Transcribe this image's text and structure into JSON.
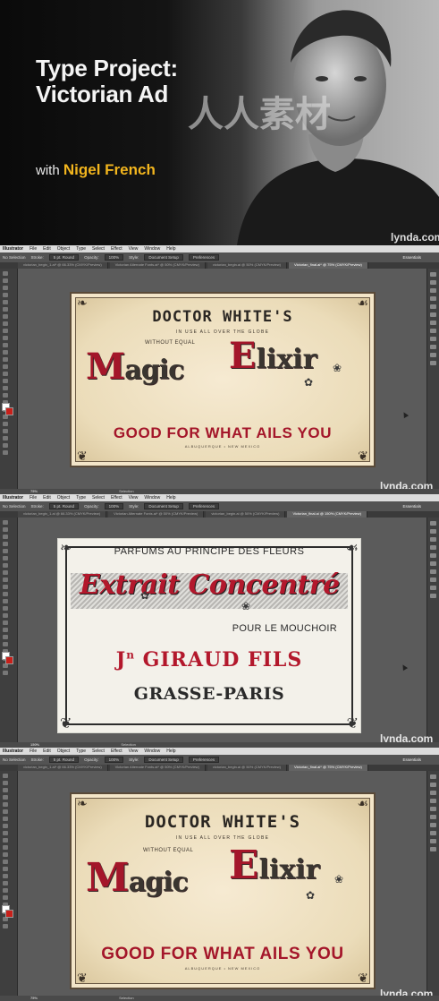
{
  "title_card": {
    "line1": "Type Project:",
    "line2": "Victorian Ad",
    "with_prefix": "with",
    "presenter": "Nigel French",
    "brand": "lynda.com",
    "accent_color": "#f2b51e"
  },
  "app": {
    "menu_app": "Illustrator",
    "menu": [
      "File",
      "Edit",
      "Object",
      "Type",
      "Select",
      "Effect",
      "View",
      "Window",
      "Help"
    ],
    "control": {
      "selection": "No Selection",
      "stroke_label": "Stroke:",
      "stroke_value": "5 pt. Round",
      "opacity_label": "Opacity:",
      "opacity_value": "100%",
      "style_label": "Style:",
      "doc_setup": "Document Setup",
      "preferences": "Preferences",
      "workspace": "Essentials"
    },
    "tabs": [
      "victorian_begin_1.ai* @ 66.33% (CMYK/Preview)",
      "Victorian Alternate Fonts.ai* @ 50% (CMYK/Preview)",
      "victorian_begin.ai @ 50% (CMYK/Preview)",
      "Victorian_final.ai* @ 75% (CMYK/Preview)"
    ],
    "tabs_frame2": [
      "victorian_begin_1.ai @ 66.33% (CMYK/Preview)",
      "Victorian Alternate Fonts.ai* @ 50% (CMYK/Preview)",
      "victorian_begin.ai @ 50% (CMYK/Preview)",
      "Victorian_final.ai @ 150% (CMYK/Preview)"
    ],
    "status_zoom": "75%",
    "status_zoom2": "150%",
    "status_tool": "Selection"
  },
  "ad": {
    "headline": "DOCTOR WHITE'S",
    "subline": "IN USE ALL OVER THE GLOBE",
    "without": "WITHOUT EQUAL",
    "magic_cap": "M",
    "magic_rest": "agic",
    "elixir_cap": "E",
    "elixir_rest": "lixir",
    "tagline": "GOOD FOR WHAT AILS YOU",
    "location": "ALBUQUERQUE • NEW MEXICO"
  },
  "perfume": {
    "line1": "PARFUMS AU PRINCIPE DES FLEURS",
    "extrait": "Extrait Concentré",
    "pour": "POUR LE MOUCHOIR",
    "jn": "J",
    "jn_sup": "n",
    "giraud": " GIRAUD FILS",
    "grasse": "GRASSE-PARIS"
  },
  "colors": {
    "victorian_red": "#a4162a",
    "parchment": "#f0e2c4"
  }
}
